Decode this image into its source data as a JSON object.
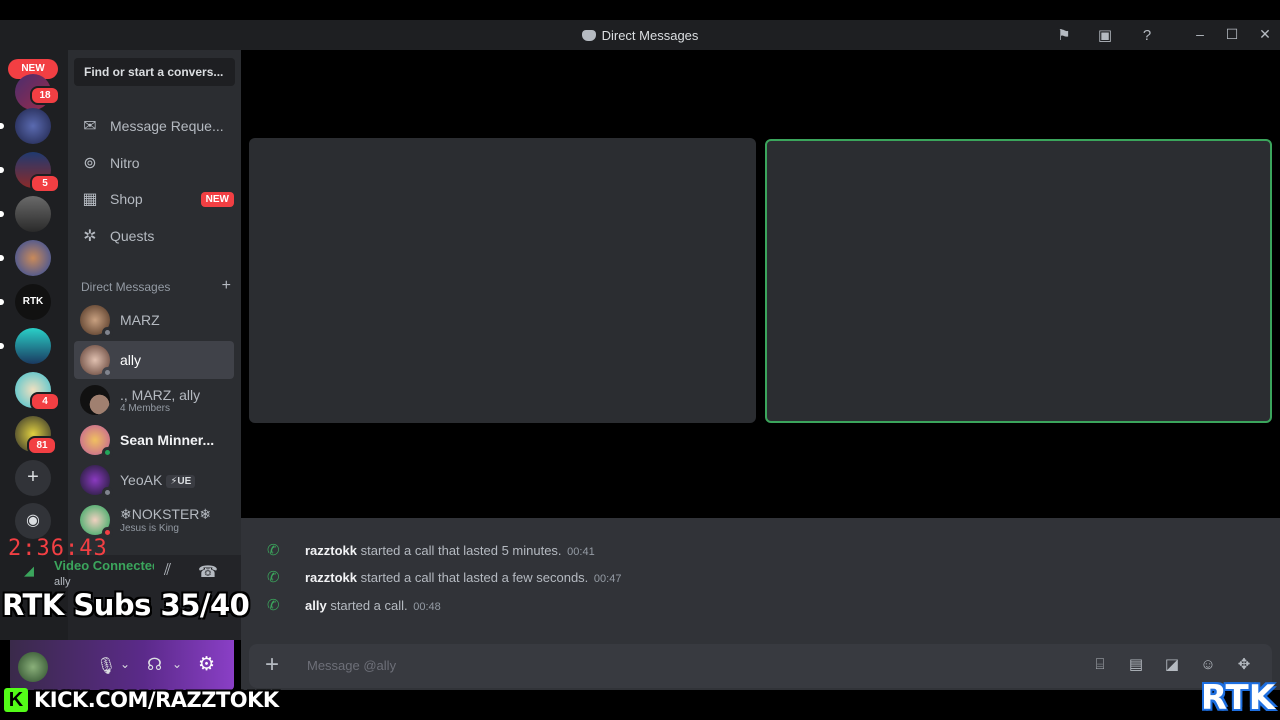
{
  "window": {
    "title": "Direct Messages"
  },
  "rail": {
    "new_label": "NEW",
    "badges": [
      "18",
      "5",
      "4",
      "81"
    ],
    "rtk_label": "RTK"
  },
  "sidebar": {
    "search_placeholder": "Find or start a convers...",
    "nav": [
      {
        "label": "Message Reque...",
        "icon": "envelope-icon"
      },
      {
        "label": "Nitro",
        "icon": "nitro-icon"
      },
      {
        "label": "Shop",
        "icon": "shop-icon",
        "tag": "NEW"
      },
      {
        "label": "Quests",
        "icon": "quests-icon"
      }
    ],
    "dm_header": "Direct Messages",
    "dms": [
      {
        "name": "MARZ"
      },
      {
        "name": "ally"
      },
      {
        "name": "., MARZ, ally",
        "sub": "4 Members"
      },
      {
        "name": "Sean Minner..."
      },
      {
        "name": "YeoAK",
        "tag": "UE"
      },
      {
        "name": "❄NOKSTER❄",
        "sub": "Jesus is King"
      }
    ]
  },
  "voice": {
    "status": "Video Connected",
    "channel": "ally"
  },
  "chat": {
    "messages": [
      {
        "user": "razztokk",
        "text": "started a call that lasted 5 minutes.",
        "time": "00:41"
      },
      {
        "user": "razztokk",
        "text": "started a call that lasted a few seconds.",
        "time": "00:47"
      },
      {
        "user": "ally",
        "text": "started a call.",
        "time": "00:48"
      }
    ],
    "composer_placeholder": "Message @ally"
  },
  "overlay": {
    "timer": "2:36:43",
    "subs": "RTK Subs 35/40",
    "kick": "KICK.COM/RAZZTOKK",
    "logo": "RTK"
  },
  "colors": {
    "accent_green": "#3ba55c",
    "alert_red": "#f23f43",
    "kick_green": "#53fc18"
  }
}
